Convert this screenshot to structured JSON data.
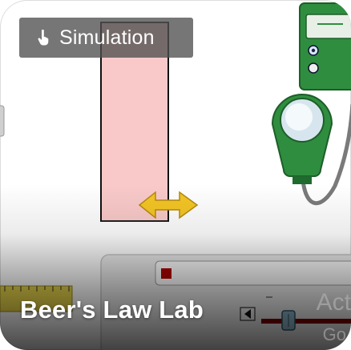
{
  "badge": {
    "icon": "pointing-hand-icon",
    "label": "Simulation"
  },
  "title": "Beer's Law Lab",
  "watermark": {
    "line1": "Act",
    "line2": "Go"
  },
  "colors": {
    "cuvette": "#f8c8c8",
    "meter": "#2e8b3e",
    "arrow": "#f0c020",
    "record": "#b00000"
  }
}
